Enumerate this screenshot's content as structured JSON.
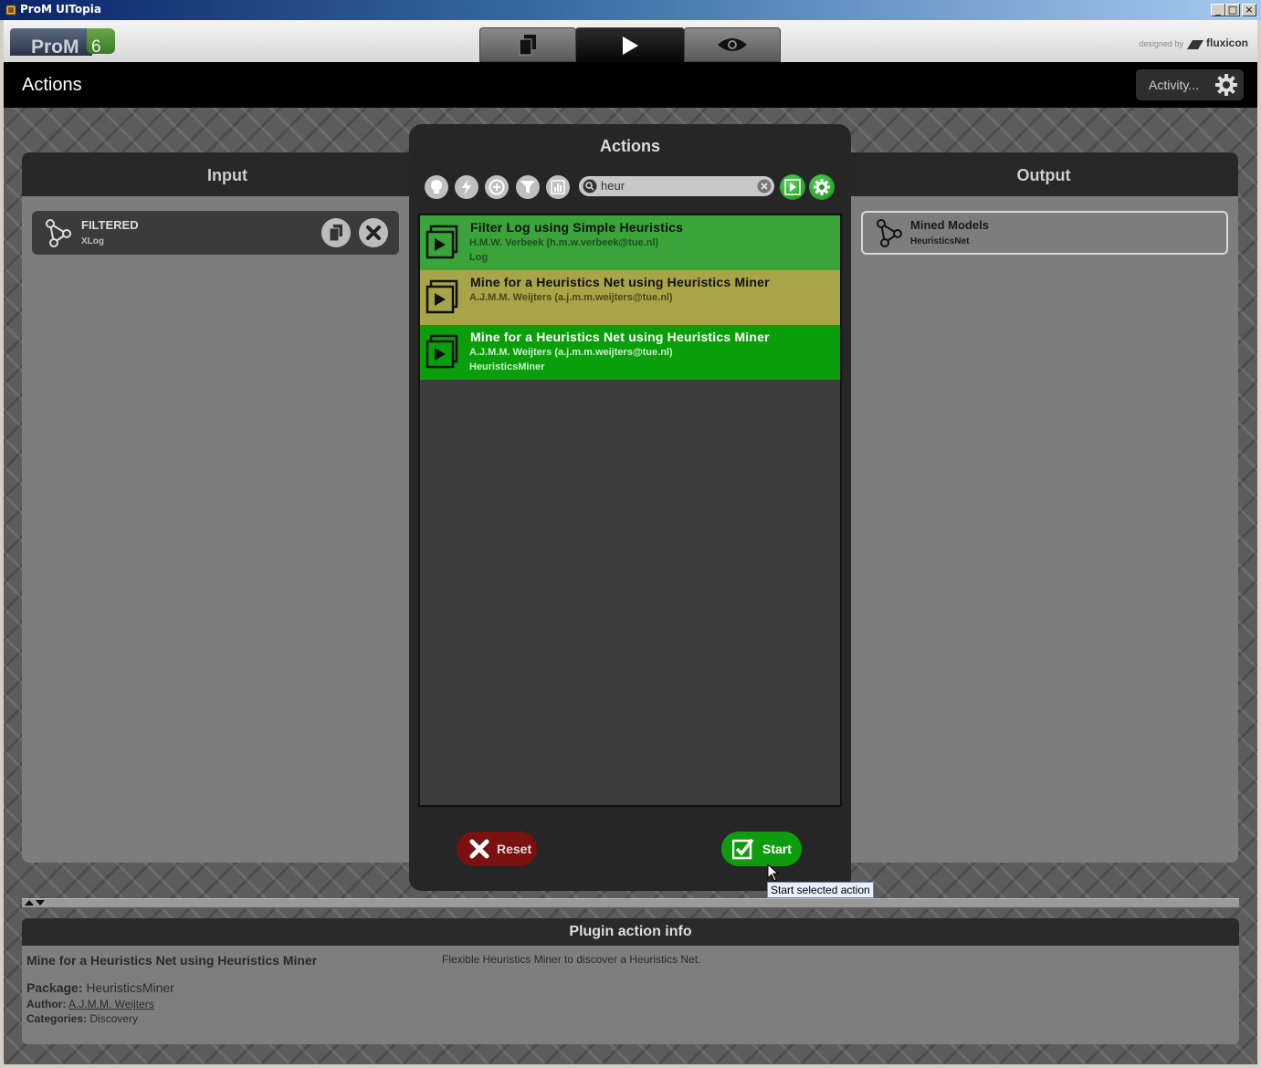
{
  "window": {
    "title": "ProM UITopia",
    "min": "_",
    "max": "□",
    "close": "×"
  },
  "header": {
    "logo_text": "ProM",
    "logo_version": "6",
    "designed_by": "designed by",
    "brand": "fluxicon"
  },
  "bar": {
    "title": "Actions",
    "activity": "Activity..."
  },
  "input": {
    "title": "Input",
    "items": [
      {
        "name": "FILTERED",
        "type": "XLog"
      }
    ]
  },
  "output": {
    "title": "Output",
    "items": [
      {
        "name": "Mined Models",
        "type": "HeuristicsNet"
      }
    ]
  },
  "dialog": {
    "title": "Actions",
    "search": {
      "value": "heur",
      "placeholder": ""
    },
    "results": [
      {
        "title": "Filter Log using Simple Heuristics",
        "author": "H.M.W. Verbeek (h.m.w.verbeek@tue.nl)",
        "package": "Log",
        "color": "#3aa43a"
      },
      {
        "title": "Mine for a Heuristics Net using Heuristics Miner",
        "author": "A.J.M.M. Weijters (a.j.m.m.weijters@tue.nl)",
        "package": "",
        "color": "#a8a448"
      },
      {
        "title": "Mine for a Heuristics Net using Heuristics Miner",
        "author": "A.J.M.M. Weijters (a.j.m.m.weijters@tue.nl)",
        "package": "HeuristicsMiner",
        "color": "#0a9e0a"
      }
    ],
    "reset": "Reset",
    "start": "Start",
    "tooltip": "Start selected action"
  },
  "info": {
    "title": "Plugin action info",
    "plugin_name": "Mine for a Heuristics Net using Heuristics Miner",
    "description": "Flexible Heuristics Miner to discover a Heuristics Net.",
    "package_label": "Package:",
    "package": "HeuristicsMiner",
    "author_label": "Author:",
    "author": "A.J.M.M. Weijters",
    "categories_label": "Categories:",
    "categories": "Discovery"
  }
}
